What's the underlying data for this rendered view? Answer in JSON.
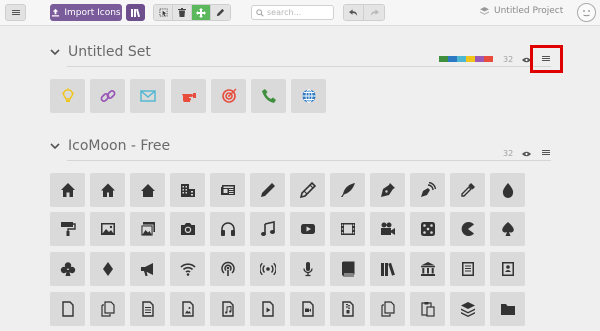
{
  "toolbar": {
    "import_label": "Import Icons",
    "search_placeholder": "search...",
    "project_name": "Untitled Project"
  },
  "sets": [
    {
      "title": "Untitled Set",
      "count": "32",
      "colors": [
        "#3f8f3f",
        "#2c79c4",
        "#4db6d1",
        "#f0c419",
        "#9b59b6",
        "#e74c3c"
      ],
      "icons": [
        "lightbulb-icon",
        "link-icon",
        "envelope-icon",
        "hand-point-icon",
        "target-icon",
        "phone-icon",
        "globe-icon"
      ]
    },
    {
      "title": "IcoMoon - Free",
      "count": "32",
      "icons": [
        [
          "home-icon",
          "home2-icon",
          "home3-icon",
          "office-icon",
          "newspaper-icon",
          "pencil-icon",
          "pencil2-icon",
          "quill-icon",
          "pen-icon",
          "blog-icon",
          "eyedropper-icon",
          "droplet-icon"
        ],
        [
          "paint-format-icon",
          "image-icon",
          "images-icon",
          "camera-icon",
          "headphones-icon",
          "music-icon",
          "play-icon",
          "film-icon",
          "video-camera-icon",
          "dice-icon",
          "pacman-icon",
          "spades-icon"
        ],
        [
          "clubs-icon",
          "diamonds-icon",
          "bullhorn-icon",
          "connection-icon",
          "podcast-icon",
          "feed-icon",
          "mic-icon",
          "book-icon",
          "books-icon",
          "library-icon",
          "file-text-icon",
          "profile-icon"
        ],
        [
          "file-empty-icon",
          "files-empty-icon",
          "file-text2-icon",
          "file-picture-icon",
          "file-music-icon",
          "file-play-icon",
          "file-video-icon",
          "file-zip-icon",
          "copy-icon",
          "paste-icon",
          "stack-icon",
          "folder-icon"
        ]
      ]
    }
  ]
}
